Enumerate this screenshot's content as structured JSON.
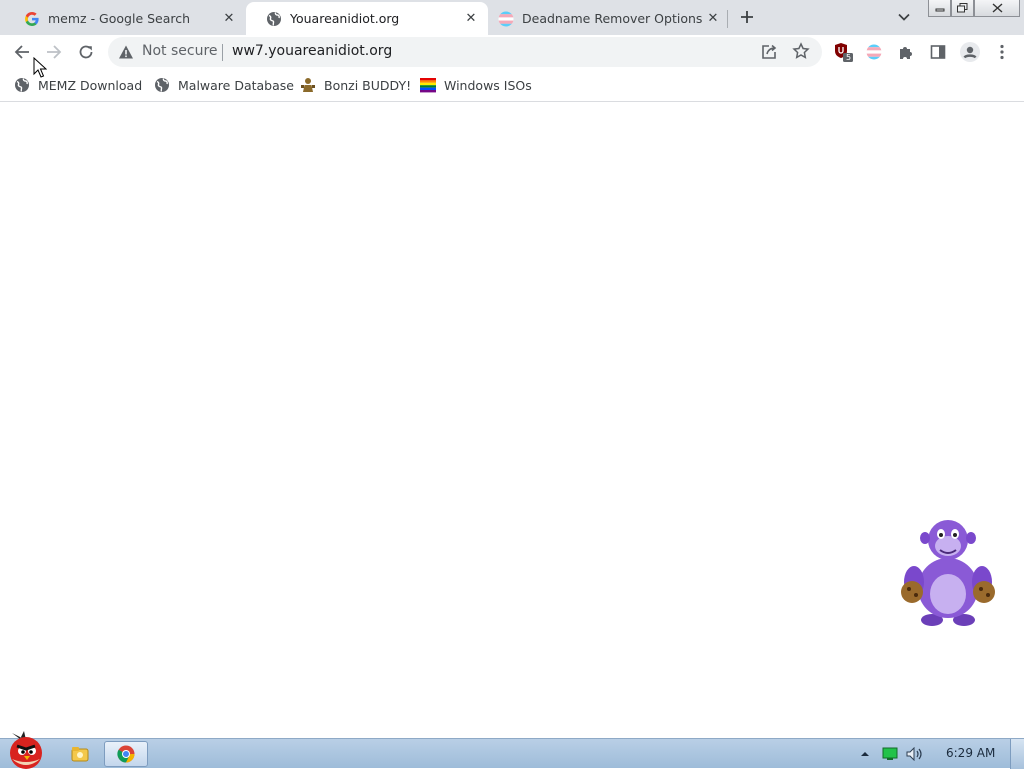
{
  "browser": {
    "tabs": [
      {
        "title": "memz - Google Search",
        "favicon": "google-g-icon",
        "active": false
      },
      {
        "title": "Youareanidiot.org",
        "favicon": "globe-icon",
        "active": true
      },
      {
        "title": "Deadname Remover Options",
        "favicon": "trans-flag-icon",
        "active": false
      }
    ],
    "close_glyph": "✕",
    "new_tab_glyph": "+",
    "window_controls": [
      "minimize-icon",
      "restore-icon",
      "close-icon"
    ]
  },
  "toolbar": {
    "security_label": "Not secure",
    "url": "ww7.youareanidiot.org",
    "extensions": [
      {
        "name": "ublock-icon",
        "badge": "5"
      },
      {
        "name": "trans-flag-extension-icon"
      },
      {
        "name": "puzzle-icon"
      },
      {
        "name": "side-panel-icon"
      },
      {
        "name": "profile-icon"
      },
      {
        "name": "kebab-menu-icon"
      }
    ]
  },
  "bookmarks": [
    {
      "label": "MEMZ Download",
      "icon": "globe-icon"
    },
    {
      "label": "Malware Database",
      "icon": "globe-icon"
    },
    {
      "label": "Bonzi BUDDY!",
      "icon": "bonzi-icon"
    },
    {
      "label": "Windows ISOs",
      "icon": "rainbow-icon"
    }
  ],
  "content": {
    "overlay": "bonzi-buddy-character"
  },
  "taskbar": {
    "start": "angry-bird-start-icon",
    "apps": [
      "explorer-icon",
      "chrome-icon"
    ],
    "tray": [
      "show-hidden-icons",
      "network-icon",
      "volume-icon"
    ],
    "clock": "6:29 AM"
  },
  "colors": {
    "tab_strip": "#dee1e6",
    "omnibox": "#f1f3f4",
    "taskbar": "#a8c3de",
    "bonzi_purple": "#8a5ad6"
  }
}
